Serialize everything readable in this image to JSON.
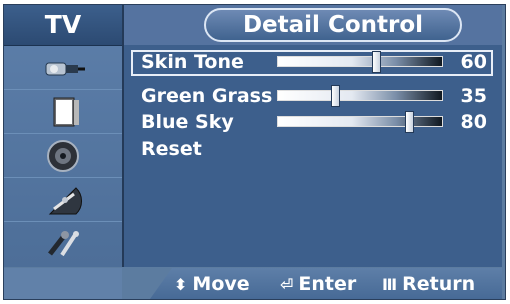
{
  "sidebar": {
    "header": "TV",
    "icons": [
      "input-plug-icon",
      "picture-panel-icon",
      "speaker-icon",
      "satellite-dish-icon",
      "tools-icon"
    ]
  },
  "title": "Detail Control",
  "rows": [
    {
      "label": "Skin Tone",
      "value": "60",
      "level": 0.6,
      "selected": true
    },
    {
      "label": "Green Grass",
      "value": "35",
      "level": 0.35,
      "selected": false
    },
    {
      "label": "Blue Sky",
      "value": "80",
      "level": 0.8,
      "selected": false
    }
  ],
  "reset_label": "Reset",
  "footer": {
    "move": {
      "glyph": "⬍",
      "label": "Move"
    },
    "enter": {
      "glyph": "⏎",
      "label": "Enter"
    },
    "return": {
      "glyph": "Ⅲ",
      "label": "Return"
    }
  }
}
